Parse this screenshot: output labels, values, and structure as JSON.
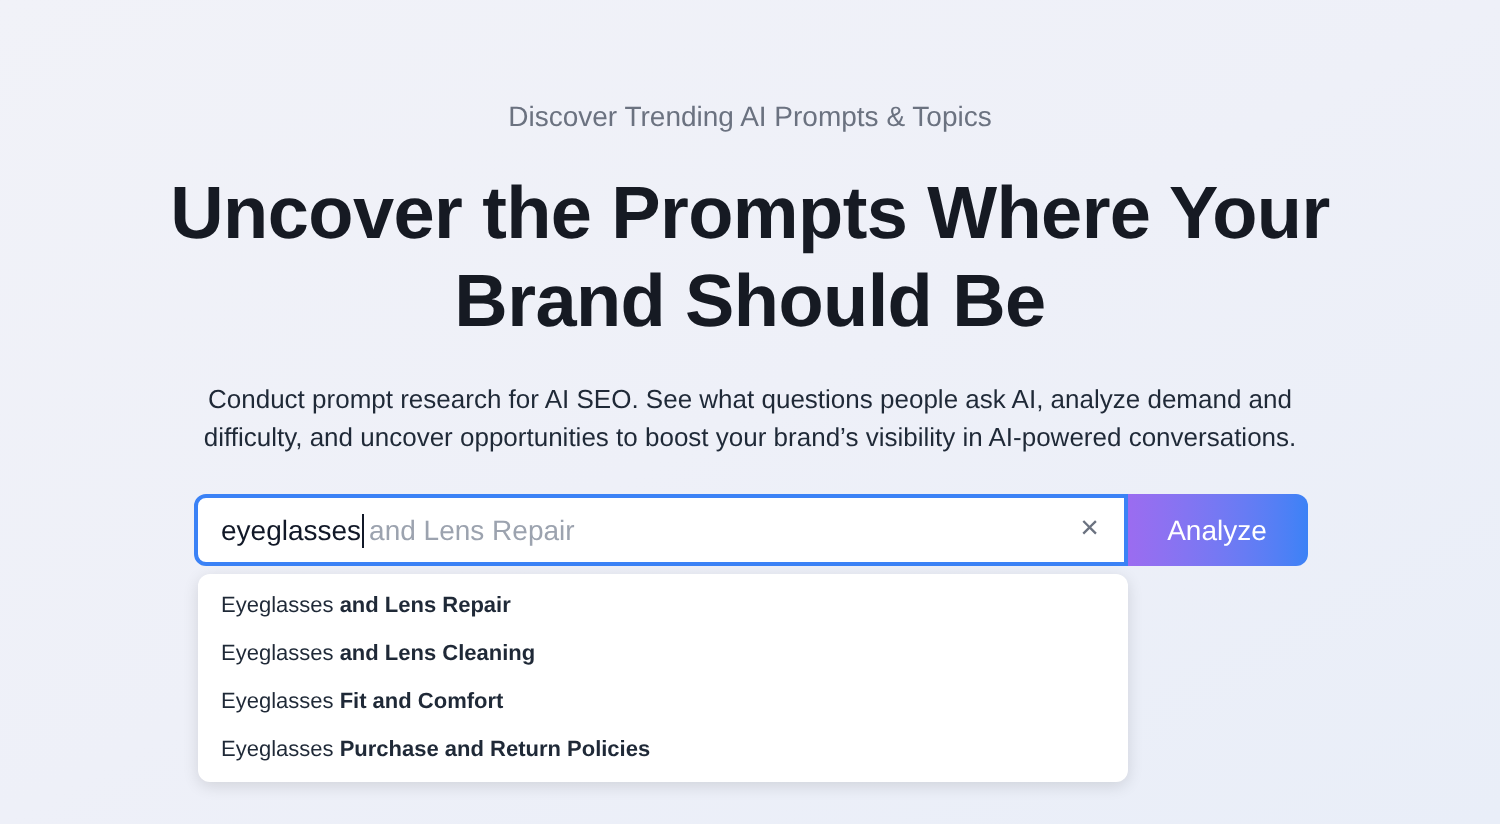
{
  "eyebrow": "Discover Trending AI Prompts & Topics",
  "heading": [
    "Uncover the Prompts Where Your",
    "Brand Should Be"
  ],
  "description": "Conduct prompt research for AI SEO. See what questions people ask AI, analyze demand and difficulty, and uncover opportunities to boost your brand’s visibility in AI-powered conversations.",
  "search": {
    "value": "eyeglasses",
    "autocomplete": "and Lens Repair",
    "clear": "×"
  },
  "analyze_button": "Analyze",
  "suggestions": [
    {
      "text": "Eyeglasses **and Lens Repair**"
    },
    {
      "text": "Eyeglasses **and Lens Cleaning**"
    },
    {
      "text": "Eyeglasses **Fit and Comfort**"
    },
    {
      "text": "Eyeglasses **Purchase and Return Policies**"
    }
  ]
}
